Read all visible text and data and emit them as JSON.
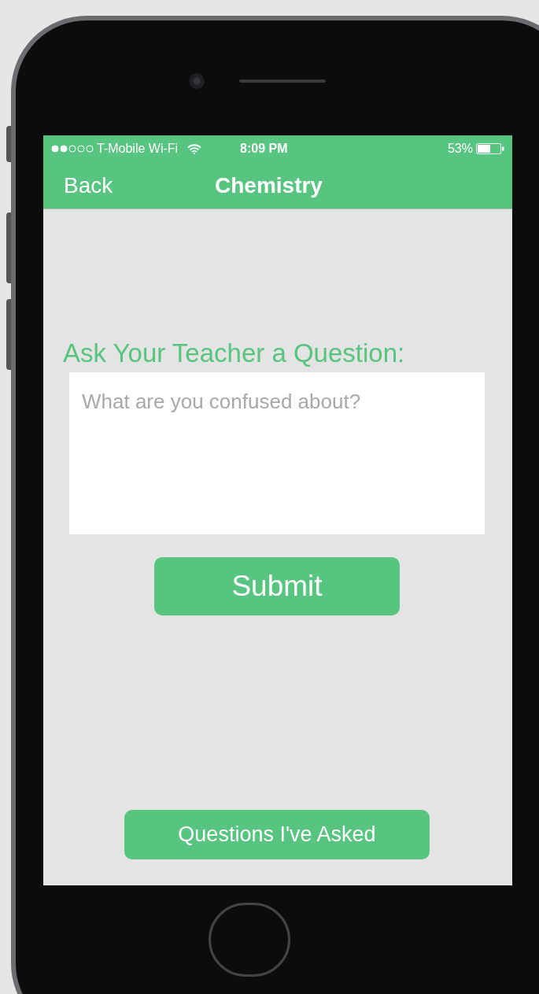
{
  "status_bar": {
    "carrier": "T-Mobile Wi-Fi",
    "time": "8:09 PM",
    "battery": "53%"
  },
  "nav_bar": {
    "back": "Back",
    "title": "Chemistry"
  },
  "heading": "Ask Your Teacher a Question:",
  "question_field": {
    "placeholder": "What are you confused about?"
  },
  "submit_button": "Submit",
  "history_button": "Questions I've Asked"
}
